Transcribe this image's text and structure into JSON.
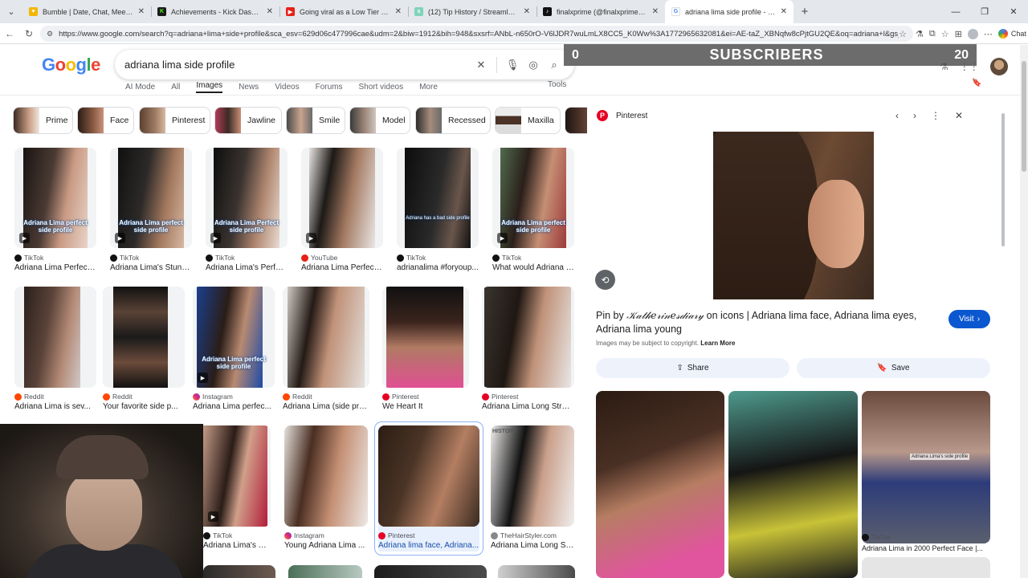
{
  "tabs": [
    {
      "title": "Bumble | Date, Chat, Meet New Pe",
      "icon": "bumble-icon",
      "color": "#f2b705"
    },
    {
      "title": "Achievements - Kick Dashboard",
      "icon": "kick-icon",
      "color": "#1a1a1a"
    },
    {
      "title": "Going viral as a Low Tier Normie -",
      "icon": "youtube-icon",
      "color": "#e62117"
    },
    {
      "title": "(12) Tip History / Streamlabs",
      "icon": "streamlabs-icon",
      "color": "#80d3b9"
    },
    {
      "title": "finalxprime (@finalxprime) | TikTok",
      "icon": "tiktok-icon",
      "color": "#111111"
    },
    {
      "title": "adriana lima side profile - Google",
      "icon": "google-icon",
      "color": "#4285f4"
    }
  ],
  "url": "https://www.google.com/search?q=adriana+lima+side+profile&sca_esv=629d06c477996cae&udm=2&biw=1912&bih=948&sxsrf=ANbL-n650rO-V6lJDR7wuLmLX8CC5_K0Ww%3A1772965632081&ei=AE-taZ_XBNqfw8cPjtGU2QE&oq=adriana+l&gs_l...",
  "chat_label": "Chat",
  "logo_letters": [
    "G",
    "o",
    "o",
    "g",
    "l",
    "e"
  ],
  "search_query": "adriana lima side profile",
  "google_tabs": [
    "AI Mode",
    "All",
    "Images",
    "News",
    "Videos",
    "Forums",
    "Short videos",
    "More"
  ],
  "tools_label": "Tools",
  "subscribers": {
    "current": "0",
    "label": "SUBSCRIBERS",
    "goal": "20"
  },
  "chips": [
    "Prime",
    "Face",
    "Pinterest",
    "Jawline",
    "Smile",
    "Model",
    "Recessed",
    "Maxilla"
  ],
  "results_row1": [
    {
      "source": "TikTok",
      "caption": "Adriana Lima Perfect ...",
      "overlay": "Adriana Lima perfect side profile",
      "video": true
    },
    {
      "source": "TikTok",
      "caption": "Adriana Lima's Stunni...",
      "overlay": "Adriana Lima perfect side profile",
      "video": true
    },
    {
      "source": "TikTok",
      "caption": "Adriana Lima's Perfec...",
      "overlay": "Adriana Lima Perfect side profile",
      "video": true
    },
    {
      "source": "YouTube",
      "caption": "Adriana Lima Perfect ...",
      "overlay": "",
      "video": true
    },
    {
      "source": "TikTok",
      "caption": "adrianalima #foryoup...",
      "overlay": "Adriana has a bad side profile",
      "video": false
    },
    {
      "source": "TikTok",
      "caption": "What would Adriana L...",
      "overlay": "Adriana Lima perfect side profile",
      "video": true
    }
  ],
  "results_row2": [
    {
      "source": "Reddit",
      "caption": "Adriana Lima is sev..."
    },
    {
      "source": "Reddit",
      "caption": "Your favorite side p..."
    },
    {
      "source": "Instagram",
      "caption": "Adriana Lima perfec...",
      "overlay": "Adriana Lima perfect side profile"
    },
    {
      "source": "Reddit",
      "caption": "Adriana Lima (side pro..."
    },
    {
      "source": "Pinterest",
      "caption": "We Heart It"
    },
    {
      "source": "Pinterest",
      "caption": "Adriana Lima Long Strai..."
    }
  ],
  "results_row3": [
    {
      "source": "TikTok",
      "caption": "Adriana Lima's Perf..."
    },
    {
      "source": "Instagram",
      "caption": "Young Adriana Lima ..."
    },
    {
      "source": "Pinterest",
      "caption": "Adriana lima face, Adriana..."
    },
    {
      "source": "TheHairStyler.com",
      "caption": "Adriana Lima Long Str...",
      "watermark": "HISTORY"
    }
  ],
  "panel": {
    "source": "Pinterest",
    "title_prefix": "Pin by",
    "author": "𝒦𝒶𝓉𝒽𝑒𝓇𝒾𝓃𝑒𝓈𝒹𝒾𝒶𝓇𝓎",
    "title_rest": "on icons | Adriana lima face, Adriana lima eyes, Adriana lima young",
    "visit_label": "Visit",
    "copyright": "Images may be subject to copyright.",
    "learn_more": "Learn More",
    "share_label": "Share",
    "save_label": "Save",
    "related": [
      {
        "source": "",
        "caption": ""
      },
      {
        "source": "",
        "caption": ""
      },
      {
        "source": "TikTok",
        "caption": "Adriana Lima in 2000 Perfect Face |...",
        "overlay": "Adriana Lima's side profile"
      }
    ]
  }
}
